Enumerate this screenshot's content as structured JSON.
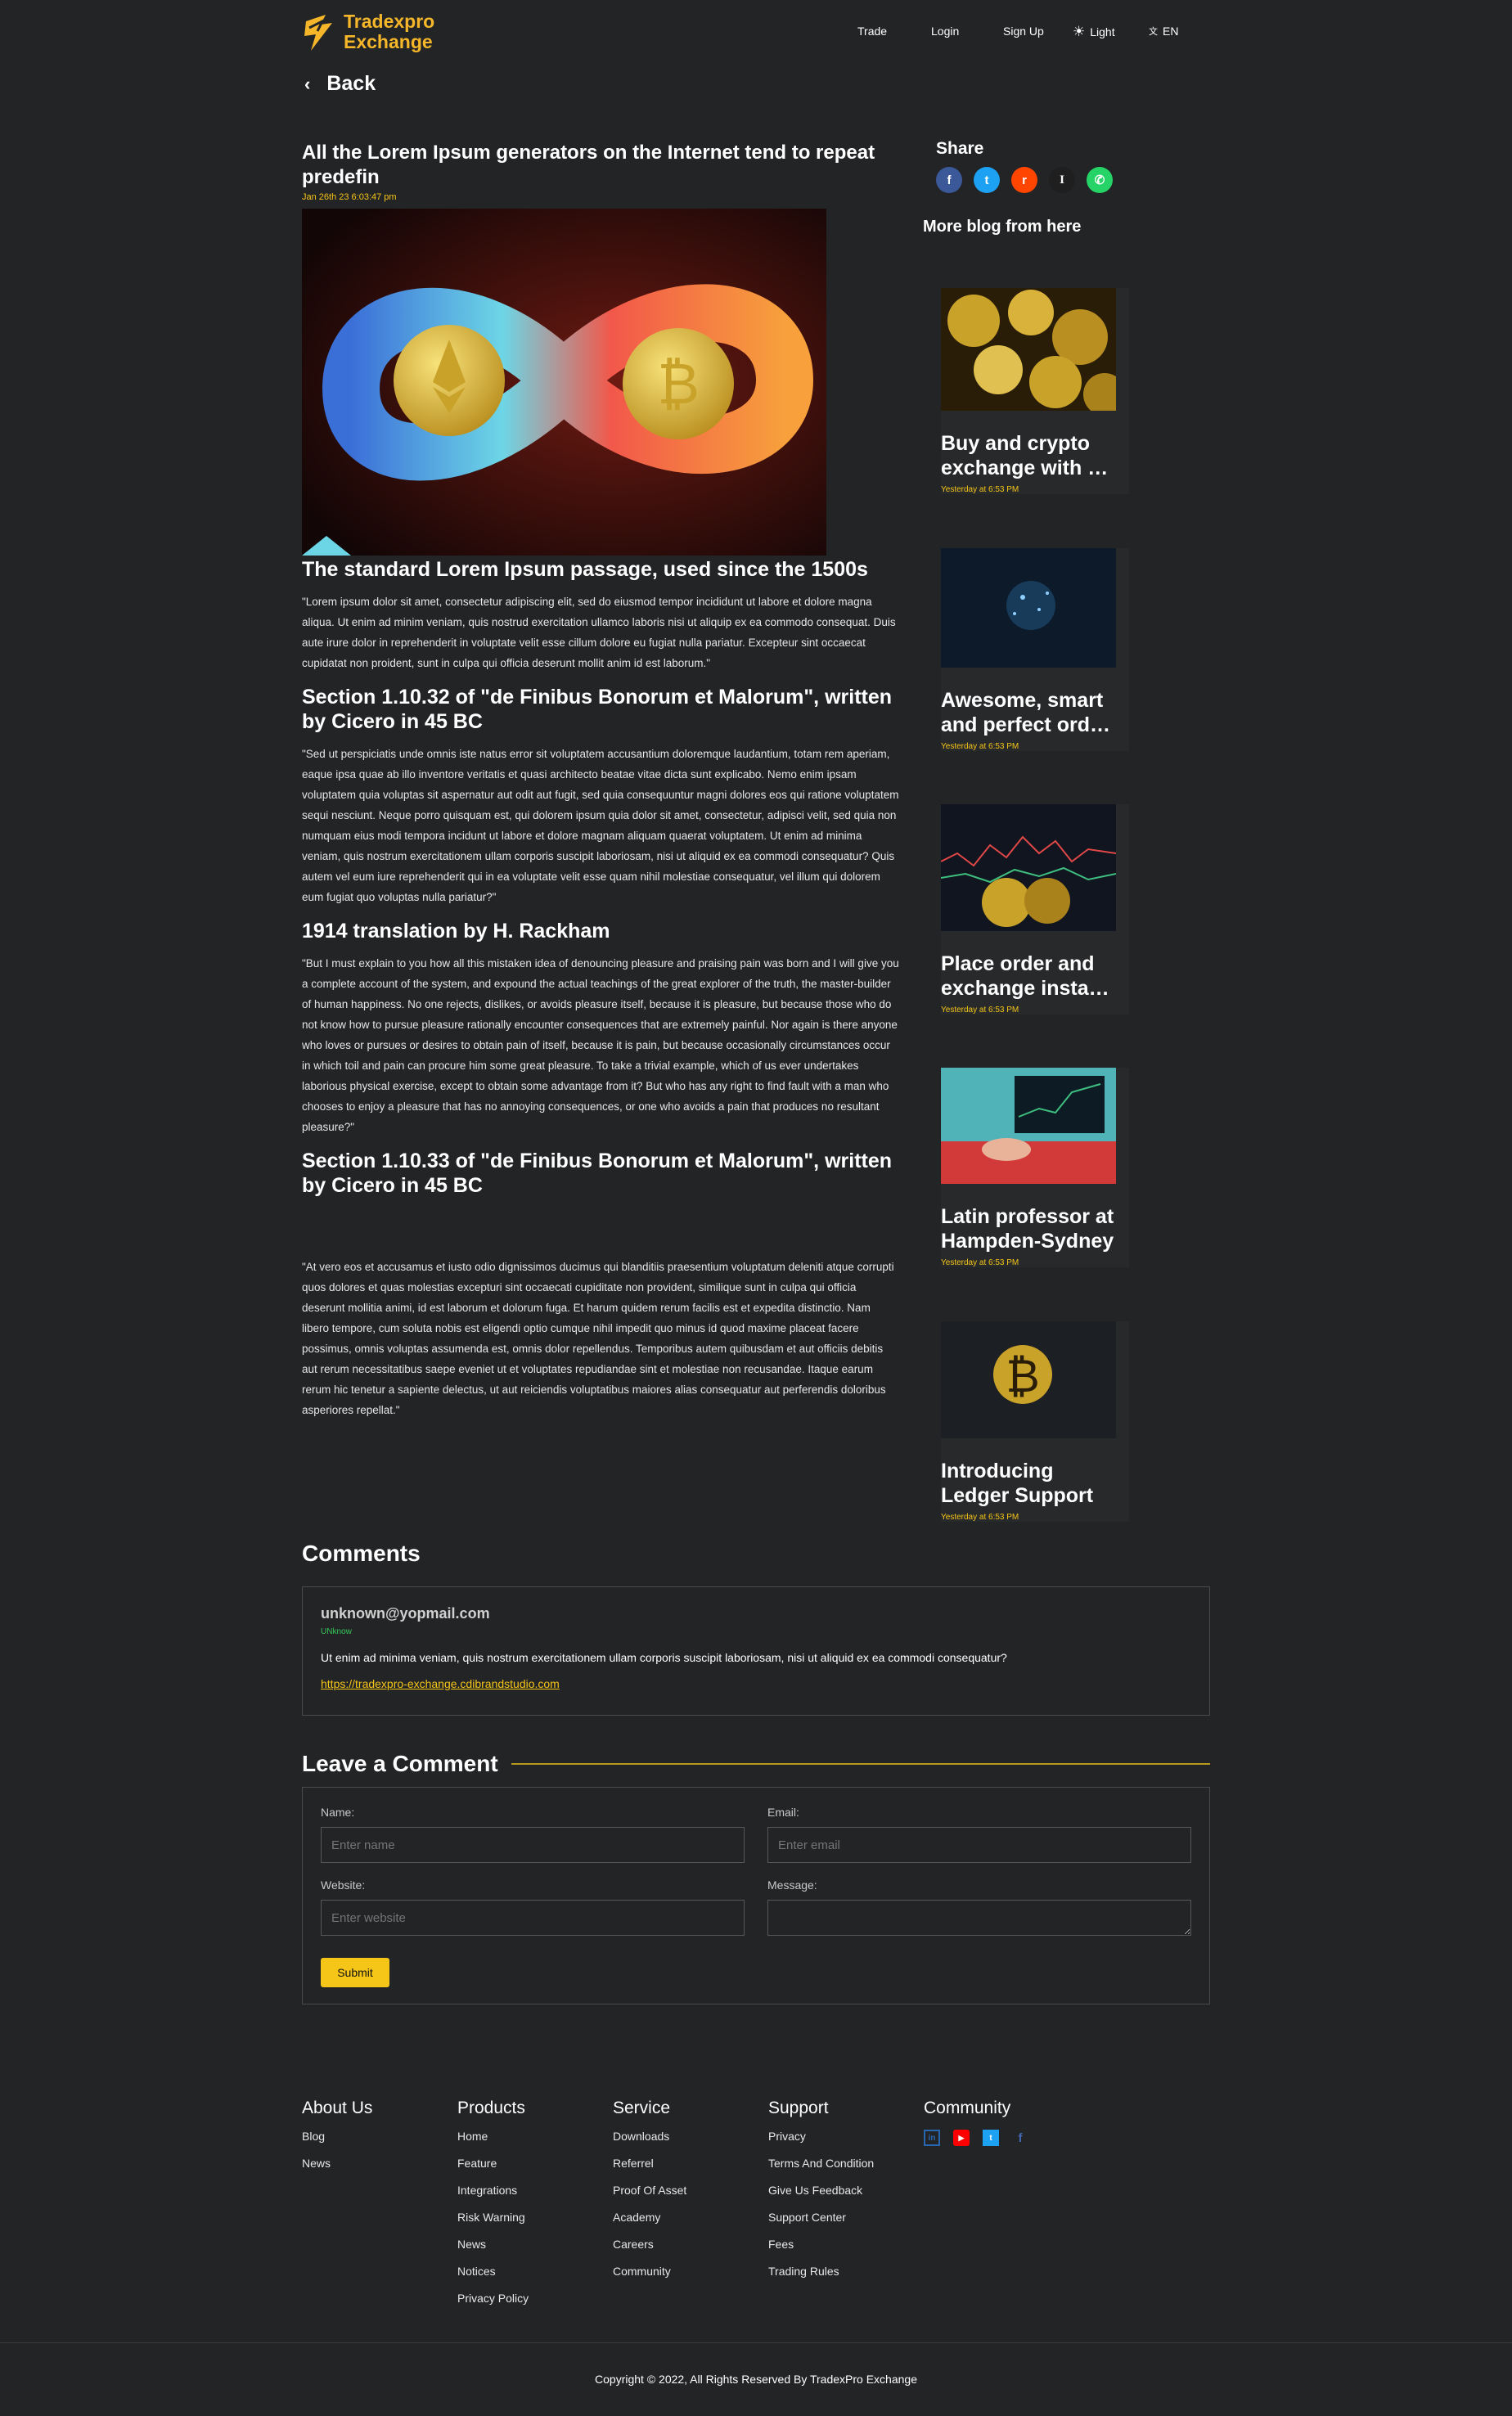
{
  "header": {
    "logo_line1": "Tradexpro",
    "logo_line2": "Exchange",
    "nav": {
      "trade": "Trade",
      "login": "Login",
      "signup": "Sign Up",
      "theme": "Light",
      "lang": "EN"
    }
  },
  "back_label": "Back",
  "article": {
    "title": "All the Lorem Ipsum generators on the Internet tend to repeat predefin",
    "date": "Jan 26th 23 6:03:47 pm",
    "h1": "The standard Lorem Ipsum passage, used since the 1500s",
    "p1": "\"Lorem ipsum dolor sit amet, consectetur adipiscing elit, sed do eiusmod tempor incididunt ut labore et dolore magna aliqua. Ut enim ad minim veniam, quis nostrud exercitation ullamco laboris nisi ut aliquip ex ea commodo consequat. Duis aute irure dolor in reprehenderit in voluptate velit esse cillum dolore eu fugiat nulla pariatur. Excepteur sint occaecat cupidatat non proident, sunt in culpa qui officia deserunt mollit anim id est laborum.\"",
    "h2": "Section 1.10.32 of \"de Finibus Bonorum et Malorum\", written by Cicero in 45 BC",
    "p2": "\"Sed ut perspiciatis unde omnis iste natus error sit voluptatem accusantium doloremque laudantium, totam rem aperiam, eaque ipsa quae ab illo inventore veritatis et quasi architecto beatae vitae dicta sunt explicabo. Nemo enim ipsam voluptatem quia voluptas sit aspernatur aut odit aut fugit, sed quia consequuntur magni dolores eos qui ratione voluptatem sequi nesciunt. Neque porro quisquam est, qui dolorem ipsum quia dolor sit amet, consectetur, adipisci velit, sed quia non numquam eius modi tempora incidunt ut labore et dolore magnam aliquam quaerat voluptatem. Ut enim ad minima veniam, quis nostrum exercitationem ullam corporis suscipit laboriosam, nisi ut aliquid ex ea commodi consequatur? Quis autem vel eum iure reprehenderit qui in ea voluptate velit esse quam nihil molestiae consequatur, vel illum qui dolorem eum fugiat quo voluptas nulla pariatur?\"",
    "h3": "1914 translation by H. Rackham",
    "p3": "\"But I must explain to you how all this mistaken idea of denouncing pleasure and praising pain was born and I will give you a complete account of the system, and expound the actual teachings of the great explorer of the truth, the master-builder of human happiness. No one rejects, dislikes, or avoids pleasure itself, because it is pleasure, but because those who do not know how to pursue pleasure rationally encounter consequences that are extremely painful. Nor again is there anyone who loves or pursues or desires to obtain pain of itself, because it is pain, but because occasionally circumstances occur in which toil and pain can procure him some great pleasure. To take a trivial example, which of us ever undertakes laborious physical exercise, except to obtain some advantage from it? But who has any right to find fault with a man who chooses to enjoy a pleasure that has no annoying consequences, or one who avoids a pain that produces no resultant pleasure?\"",
    "h4": "Section 1.10.33 of \"de Finibus Bonorum et Malorum\", written by Cicero in 45 BC",
    "p4": "\"At vero eos et accusamus et iusto odio dignissimos ducimus qui blanditiis praesentium voluptatum deleniti atque corrupti quos dolores et quas molestias excepturi sint occaecati cupiditate non provident, similique sunt in culpa qui officia deserunt mollitia animi, id est laborum et dolorum fuga. Et harum quidem rerum facilis est et expedita distinctio. Nam libero tempore, cum soluta nobis est eligendi optio cumque nihil impedit quo minus id quod maxime placeat facere possimus, omnis voluptas assumenda est, omnis dolor repellendus. Temporibus autem quibusdam et aut officiis debitis aut rerum necessitatibus saepe eveniet ut et voluptates repudiandae sint et molestiae non recusandae. Itaque earum rerum hic tenetur a sapiente delectus, ut aut reiciendis voluptatibus maiores alias consequatur aut perferendis doloribus asperiores repellat.\""
  },
  "sidebar": {
    "share_title": "Share",
    "share_icons": [
      "facebook-icon",
      "twitter-icon",
      "reddit-icon",
      "instapaper-icon",
      "whatsapp-icon"
    ],
    "more_title": "More blog from here",
    "posts": [
      {
        "title": "Buy and crypto exchange with Tradexpro",
        "date": "Yesterday at 6:53 PM"
      },
      {
        "title": "Awesome, smart and perfect order book",
        "date": "Yesterday at 6:53 PM"
      },
      {
        "title": "Place order and exchange instantly",
        "date": "Yesterday at 6:53 PM"
      },
      {
        "title": "Latin professor at Hampden-Sydney",
        "date": "Yesterday at 6:53 PM"
      },
      {
        "title": "Introducing Ledger Support",
        "date": "Yesterday at 6:53 PM"
      }
    ]
  },
  "comments": {
    "title": "Comments",
    "items": [
      {
        "email": "unknown@yopmail.com",
        "role": "UNknow",
        "text": "Ut enim ad minima veniam, quis nostrum exercitationem ullam corporis suscipit laboriosam, nisi ut aliquid ex ea commodi consequatur?",
        "link": "https://tradexpro-exchange.cdibrandstudio.com"
      }
    ]
  },
  "leave": {
    "title": "Leave a Comment",
    "name_label": "Name:",
    "name_ph": "Enter name",
    "email_label": "Email:",
    "email_ph": "Enter email",
    "website_label": "Website:",
    "website_ph": "Enter website",
    "message_label": "Message:",
    "submit": "Submit"
  },
  "footer": {
    "about": {
      "title": "About Us",
      "items": [
        "Blog",
        "News"
      ]
    },
    "products": {
      "title": "Products",
      "items": [
        "Home",
        "Feature",
        "Integrations",
        "Risk Warning",
        "News",
        "Notices",
        "Privacy Policy"
      ]
    },
    "service": {
      "title": "Service",
      "items": [
        "Downloads",
        "Referrel",
        "Proof Of Asset",
        "Academy",
        "Careers",
        "Community"
      ]
    },
    "support": {
      "title": "Support",
      "items": [
        "Privacy",
        "Terms And Condition",
        "Give Us Feedback",
        "Support Center",
        "Fees",
        "Trading Rules"
      ]
    },
    "community": {
      "title": "Community",
      "icons": [
        "linkedin-icon",
        "youtube-icon",
        "twitter-icon",
        "facebook-icon"
      ]
    },
    "copyright": "Copyright © 2022, All Rights Reserved By TradexPro Exchange"
  },
  "colors": {
    "bg": "#232426",
    "accent": "#f5c518",
    "brand": "#f5b62a"
  }
}
